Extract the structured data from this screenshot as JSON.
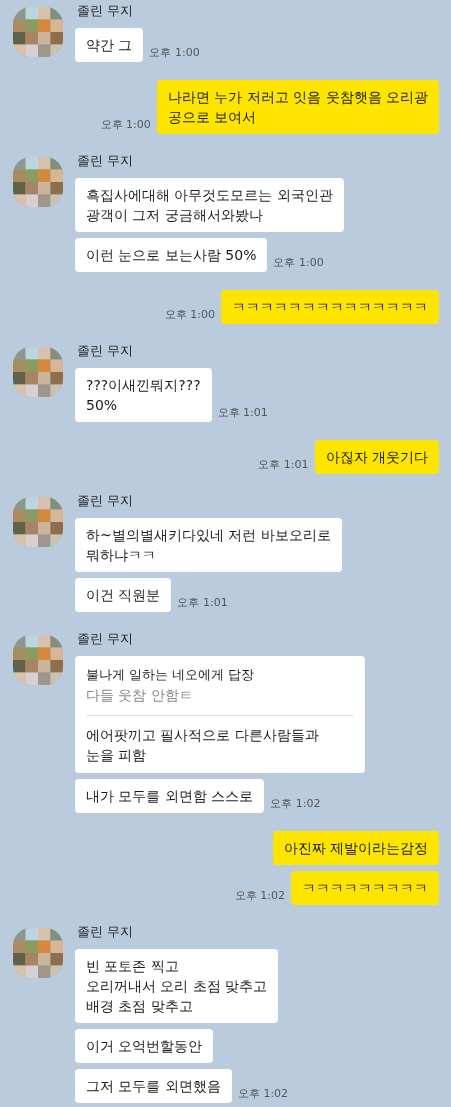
{
  "groups": [
    {
      "kind": "received",
      "sender": "졸린 무지",
      "messages": [
        {
          "kind": "text",
          "text": "약간 그"
        }
      ],
      "time": "오후 1:00"
    },
    {
      "kind": "sent",
      "messages": [
        {
          "kind": "text",
          "text": "나라면 누가 저러고 잇음 웃참햇음 오리광\n공으로 보여서"
        }
      ],
      "time": "오후 1:00"
    },
    {
      "kind": "received",
      "sender": "졸린 무지",
      "messages": [
        {
          "kind": "text",
          "text": "흑집사에대해 아무것도모르는 외국인관\n광객이 그저 궁금해서와봤나"
        },
        {
          "kind": "text",
          "text": "이런 눈으로 보는사람 50%"
        }
      ],
      "time": "오후 1:00"
    },
    {
      "kind": "sent",
      "messages": [
        {
          "kind": "text",
          "text": "ㅋㅋㅋㅋㅋㅋㅋㅋㅋㅋㅋㅋㅋㅋ"
        }
      ],
      "time": "오후 1:00"
    },
    {
      "kind": "received",
      "sender": "졸린 무지",
      "messages": [
        {
          "kind": "text",
          "text": "???이새낀뭐지???\n50%"
        }
      ],
      "time": "오후 1:01"
    },
    {
      "kind": "sent",
      "messages": [
        {
          "kind": "text",
          "text": "아짆자 개웃기다"
        }
      ],
      "time": "오후 1:01"
    },
    {
      "kind": "received",
      "sender": "졸린 무지",
      "messages": [
        {
          "kind": "text",
          "text": "하~별의별새키다있네 저런 바보오리로\n뭐하냐ㅋㅋ"
        },
        {
          "kind": "text",
          "text": "이건 직원분"
        }
      ],
      "time": "오후 1:01"
    },
    {
      "kind": "received",
      "sender": "졸린 무지",
      "messages": [
        {
          "kind": "reply",
          "quote_title": "불나게 일하는 네오에게 답장",
          "quote_text": "다들 웃참 안함ㅌ",
          "text": "에어팟끼고 필사적으로 다른사람들과\n눈을 피함"
        },
        {
          "kind": "text",
          "text": "내가 모두를 외면함 스스로"
        }
      ],
      "time": "오후 1:02"
    },
    {
      "kind": "sent",
      "messages": [
        {
          "kind": "text",
          "text": "아진짜 제발이라는감정"
        },
        {
          "kind": "text",
          "text": "ㅋㅋㅋㅋㅋㅋㅋㅋㅋ"
        }
      ],
      "time": "오후 1:02"
    },
    {
      "kind": "received",
      "sender": "졸린 무지",
      "messages": [
        {
          "kind": "text",
          "text": "빈 포토존 찍고\n오리꺼내서 오리 초점 맞추고\n배경 초점 맞추고"
        },
        {
          "kind": "text",
          "text": "이거 오억번할동안"
        },
        {
          "kind": "text",
          "text": "그저 모두를 외면했음"
        }
      ],
      "time": "오후 1:02"
    }
  ]
}
